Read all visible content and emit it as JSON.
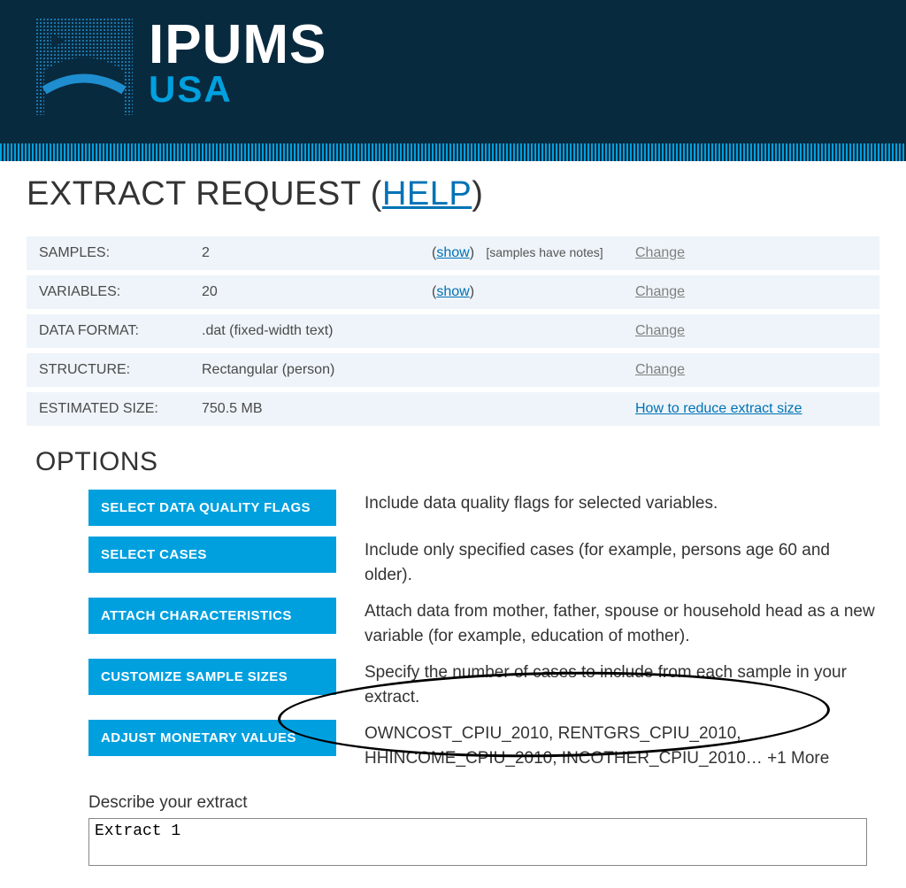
{
  "logo": {
    "main": "IPUMS",
    "sub": "USA"
  },
  "page": {
    "title_prefix": "EXTRACT REQUEST (",
    "title_link": "HELP",
    "title_suffix": ")"
  },
  "summary": {
    "rows": [
      {
        "label": "SAMPLES:",
        "value": "2",
        "show": "show",
        "note": "[samples have notes]",
        "action": "Change"
      },
      {
        "label": "VARIABLES:",
        "value": "20",
        "show": "show",
        "note": "",
        "action": "Change"
      },
      {
        "label": "DATA FORMAT:",
        "value": ".dat (fixed-width text)",
        "show": "",
        "note": "",
        "action": "Change"
      },
      {
        "label": "STRUCTURE:",
        "value": "Rectangular (person)",
        "show": "",
        "note": "",
        "action": "Change"
      },
      {
        "label": "ESTIMATED SIZE:",
        "value": "750.5 MB",
        "show": "",
        "note": "",
        "action": "How to reduce extract size"
      }
    ]
  },
  "options_heading": "OPTIONS",
  "options": [
    {
      "button": "SELECT DATA QUALITY FLAGS",
      "desc": "Include data quality flags for selected variables."
    },
    {
      "button": "SELECT CASES",
      "desc": "Include only specified cases (for example, persons age 60 and older)."
    },
    {
      "button": "ATTACH CHARACTERISTICS",
      "desc": "Attach data from mother, father, spouse or household head as a new variable (for example, education of mother)."
    },
    {
      "button": "CUSTOMIZE SAMPLE SIZES",
      "desc": "Specify the number of cases to include from each sample in your extract."
    },
    {
      "button": "ADJUST MONETARY VALUES",
      "desc": "OWNCOST_CPIU_2010, RENTGRS_CPIU_2010, HHINCOME_CPIU_2010, INCOTHER_CPIU_2010… +1 More"
    }
  ],
  "describe": {
    "label": "Describe your extract",
    "value": "Extract 1"
  }
}
